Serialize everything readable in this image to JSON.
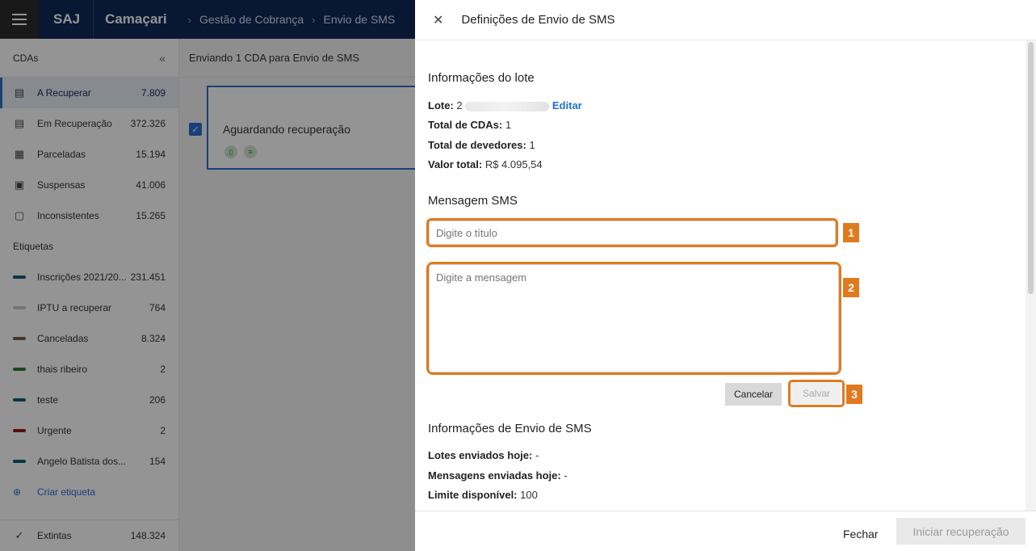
{
  "topbar": {
    "brand": "SAJ",
    "city": "Camaçari",
    "breadcrumbs": [
      "Gestão de Cobrança",
      "Envio de SMS"
    ]
  },
  "sidebar": {
    "header": "CDAs",
    "collapse_icon": "«",
    "cdas": [
      {
        "label": "A Recuperar",
        "count": "7.809",
        "icon": "document-money-icon"
      },
      {
        "label": "Em Recuperação",
        "count": "372.326",
        "icon": "document-money-icon"
      },
      {
        "label": "Parceladas",
        "count": "15.194",
        "icon": "calendar-money-icon"
      },
      {
        "label": "Suspensas",
        "count": "41.006",
        "icon": "document-suspended-icon"
      },
      {
        "label": "Inconsistentes",
        "count": "15.265",
        "icon": "document-warning-icon"
      }
    ],
    "tags_header": "Etiquetas",
    "tags": [
      {
        "label": "Inscrições 2021/20...",
        "count": "231.451",
        "color": "#0d5f7a"
      },
      {
        "label": "IPTU a recuperar",
        "count": "764",
        "color": "#c8c8c8"
      },
      {
        "label": "Canceladas",
        "count": "8.324",
        "color": "#7a5c4a"
      },
      {
        "label": "thais ribeiro",
        "count": "2",
        "color": "#2f7a2f"
      },
      {
        "label": "teste",
        "count": "206",
        "color": "#0d5f7a"
      },
      {
        "label": "Urgente",
        "count": "2",
        "color": "#9a1b1b"
      },
      {
        "label": "Angelo Batista dos...",
        "count": "154",
        "color": "#0d5f7a"
      }
    ],
    "create_tag": "Criar etiqueta",
    "extinct": {
      "label": "Extintas",
      "count": "148.324"
    }
  },
  "main": {
    "header": "Enviando 1 CDA para  Envio de SMS",
    "card_title": "Aguardando recuperação"
  },
  "panel": {
    "title": "Definições de Envio de SMS",
    "batch_info_title": "Informações do lote",
    "batch_label": "Lote:",
    "batch_value": "2",
    "edit_link": "Editar",
    "total_cdas_label": "Total de CDAs:",
    "total_cdas_value": "1",
    "total_debtors_label": "Total de devedores:",
    "total_debtors_value": "1",
    "total_value_label": "Valor total:",
    "total_value_value": "R$ 4.095,54",
    "sms_title": "Mensagem SMS",
    "title_placeholder": "Digite o título",
    "message_placeholder": "Digite a mensagem",
    "badge_1": "1",
    "badge_2": "2",
    "badge_3": "3",
    "cancel_label": "Cancelar",
    "save_label": "Salvar",
    "send_info_title": "Informações de Envio de SMS",
    "batches_today_label": "Lotes enviados hoje:",
    "batches_today_value": "-",
    "messages_today_label": "Mensagens enviadas hoje:",
    "messages_today_value": "-",
    "limit_label": "Limite disponível:",
    "limit_value": "100",
    "close_label": "Fechar",
    "start_label": "Iniciar recuperação"
  }
}
